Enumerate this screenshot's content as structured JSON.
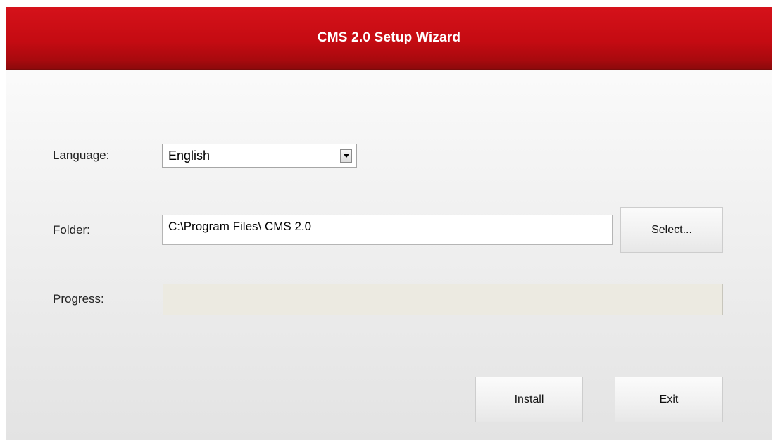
{
  "window": {
    "title": "CMS 2.0 Setup Wizard"
  },
  "form": {
    "language_label": "Language:",
    "language_value": "English",
    "folder_label": "Folder:",
    "folder_value": "C:\\Program Files\\ CMS 2.0",
    "select_button": "Select...",
    "progress_label": "Progress:",
    "progress_value": 0
  },
  "actions": {
    "install": "Install",
    "exit": "Exit"
  },
  "colors": {
    "titlebar": "#c50b12",
    "title_text": "#ffffff",
    "progress_track": "#eceae1"
  }
}
